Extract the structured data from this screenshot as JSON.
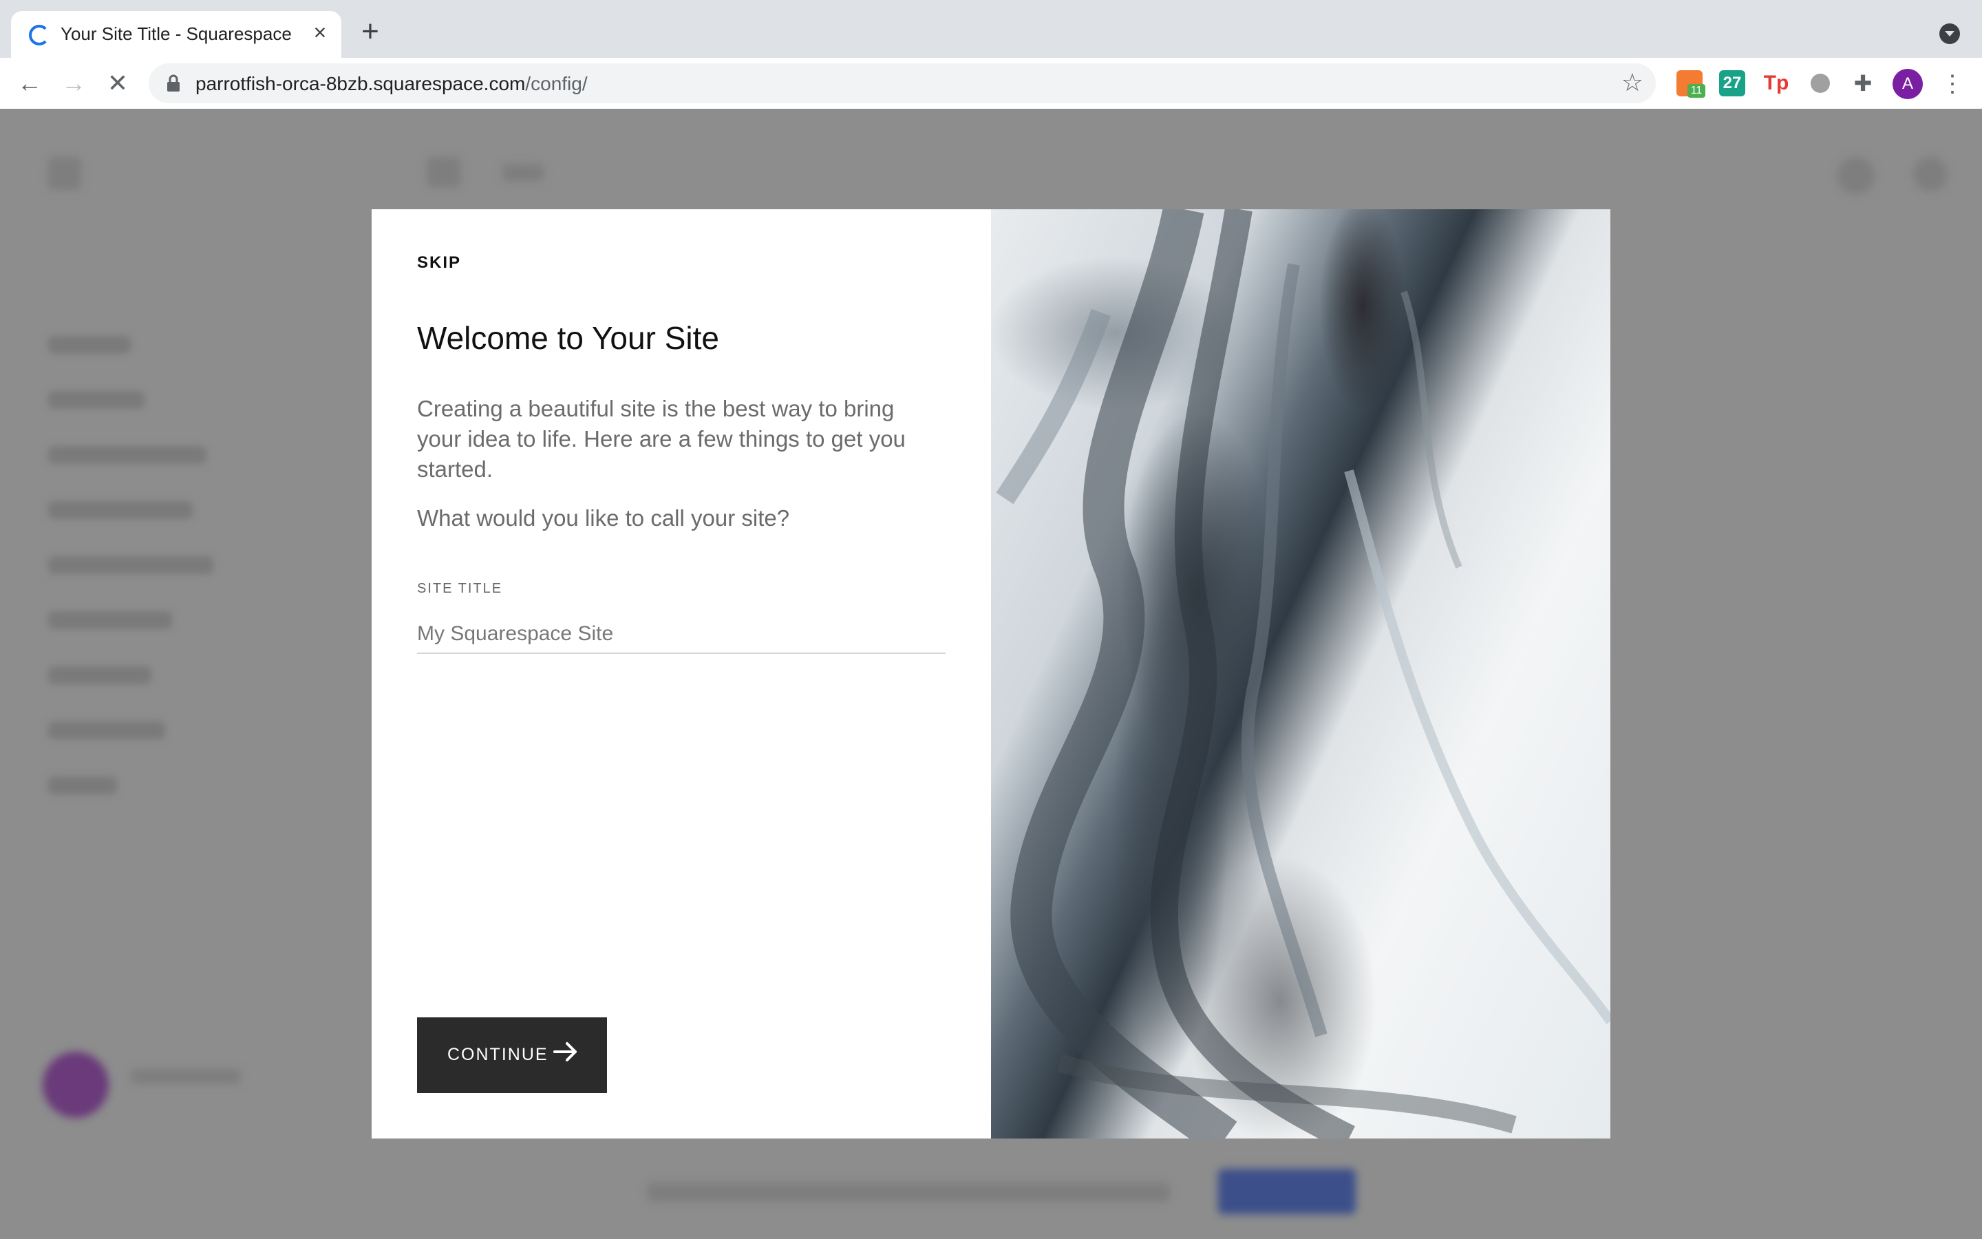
{
  "browser": {
    "tab_title": "Your Site Title - Squarespace",
    "url_host": "parrotfish-orca-8bzb.squarespace.com",
    "url_path": "/config/",
    "new_tab_label": "+",
    "extensions": [
      {
        "icon": "calendar-ext-icon",
        "badge": "11"
      },
      {
        "icon": "day-27-ext-icon",
        "label": "27"
      },
      {
        "icon": "tp-ext-icon",
        "label": "Tp"
      },
      {
        "icon": "circle-ext-icon"
      },
      {
        "icon": "puzzle-extensions-icon"
      }
    ],
    "profile_initial": "A"
  },
  "modal": {
    "skip_label": "SKIP",
    "heading": "Welcome to Your Site",
    "description": "Creating a beautiful site is the best way to bring your idea to life. Here are a few things to get you started.",
    "question": "What would you like to call your site?",
    "site_title_label": "SITE TITLE",
    "site_title_value": "My Squarespace Site",
    "continue_label": "CONTINUE"
  },
  "colors": {
    "overlay": "#8a8a8a",
    "button_bg": "#2b2b2b",
    "profile": "#7b1fa2",
    "spinner": "#1a73e8"
  }
}
